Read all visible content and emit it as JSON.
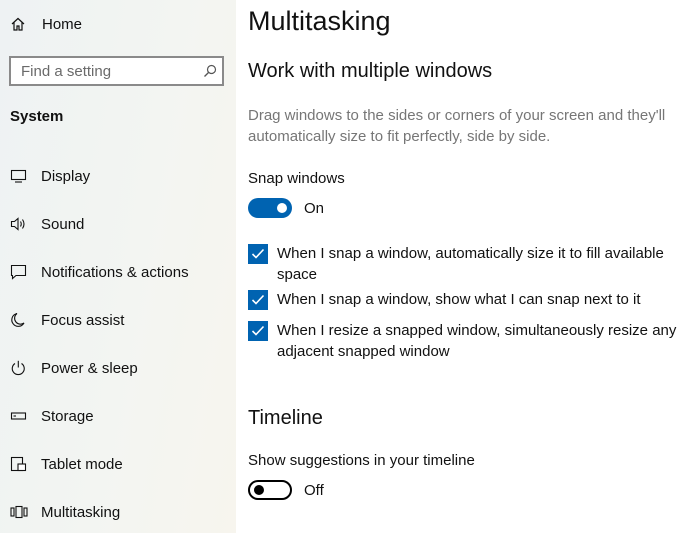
{
  "sidebar": {
    "home_label": "Home",
    "search_placeholder": "Find a setting",
    "section_title": "System",
    "items": [
      {
        "label": "Display",
        "icon": "display-icon"
      },
      {
        "label": "Sound",
        "icon": "sound-icon"
      },
      {
        "label": "Notifications & actions",
        "icon": "notifications-icon"
      },
      {
        "label": "Focus assist",
        "icon": "moon-icon"
      },
      {
        "label": "Power & sleep",
        "icon": "power-icon"
      },
      {
        "label": "Storage",
        "icon": "storage-icon"
      },
      {
        "label": "Tablet mode",
        "icon": "tablet-icon"
      },
      {
        "label": "Multitasking",
        "icon": "multitasking-icon"
      }
    ]
  },
  "main": {
    "title": "Multitasking",
    "windows_section": {
      "heading": "Work with multiple windows",
      "description": "Drag windows to the sides or corners of your screen and they'll automatically size to fit perfectly, side by side.",
      "snap_label": "Snap windows",
      "snap_state": "On",
      "snap_on": true,
      "options": [
        {
          "label": "When I snap a window, automatically size it to fill available space",
          "checked": true
        },
        {
          "label": "When I snap a window, show what I can snap next to it",
          "checked": true
        },
        {
          "label": "When I resize a snapped window, simultaneously resize any adjacent snapped window",
          "checked": true
        }
      ]
    },
    "timeline_section": {
      "heading": "Timeline",
      "suggestions_label": "Show suggestions in your timeline",
      "suggestions_state": "Off",
      "suggestions_on": false
    }
  },
  "colors": {
    "accent": "#0063b1",
    "description_text": "#767676"
  }
}
